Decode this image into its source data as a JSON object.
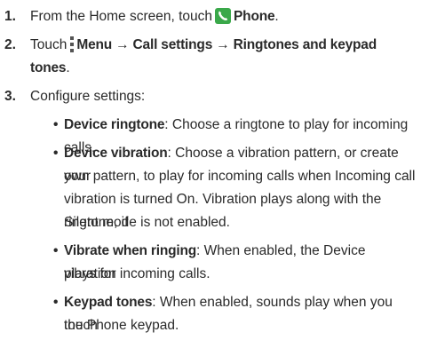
{
  "steps": [
    {
      "number": "1.",
      "prefix": "From the Home screen, touch",
      "icon": "phone-icon",
      "bold": "Phone",
      "suffix": "."
    },
    {
      "number": "2.",
      "prefix": "Touch",
      "icon": "menu-icon",
      "bold_line1": "Menu → Call settings → Ringtones and keypad",
      "bold_line2": "tones",
      "suffix": "."
    },
    {
      "number": "3.",
      "text": "Configure settings:"
    }
  ],
  "bullets": [
    {
      "term": "Device ringtone",
      "lines": [
        ": Choose a ringtone to play for incoming calls."
      ]
    },
    {
      "term": "Device vibration",
      "lines": [
        ": Choose a vibration pattern, or create your",
        "own pattern, to play for incoming calls when Incoming call",
        "vibration is turned On. Vibration plays along with the ringtone, if",
        "Silent mode is not enabled."
      ]
    },
    {
      "term": "Vibrate when ringing",
      "lines": [
        ": When enabled, the Device vibration",
        "plays for incoming calls."
      ]
    },
    {
      "term": "Keypad tones",
      "lines": [
        ": When enabled, sounds play when you touch",
        "the Phone keypad."
      ]
    }
  ],
  "colors": {
    "text": "#2a2a2a",
    "phone_icon_bg": "#3aa84a"
  }
}
